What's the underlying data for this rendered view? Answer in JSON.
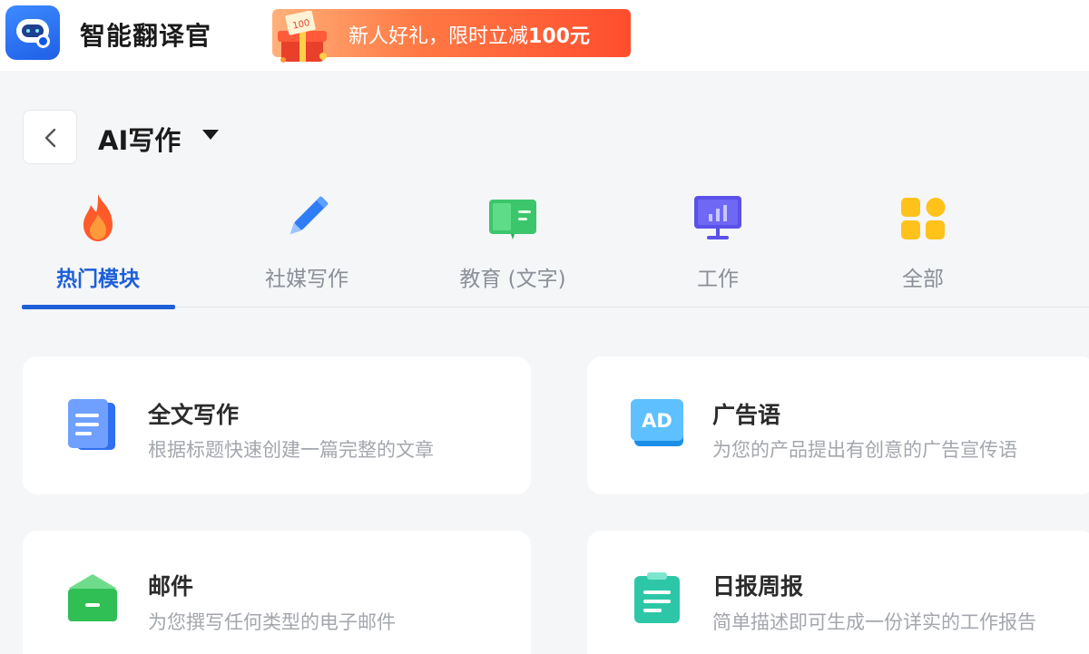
{
  "header": {
    "app_name": "智能翻译官",
    "promo": {
      "text_prefix": "新人好礼，限时立减",
      "amount": "100元",
      "coupon_value": "100"
    }
  },
  "page": {
    "title": "AI写作"
  },
  "tabs": [
    {
      "label": "热门模块",
      "icon": "fire-icon",
      "active": true
    },
    {
      "label": "社媒写作",
      "icon": "pencil-icon",
      "active": false
    },
    {
      "label": "教育 (文字)",
      "icon": "book-icon",
      "active": false
    },
    {
      "label": "工作",
      "icon": "presentation-icon",
      "active": false
    },
    {
      "label": "全部",
      "icon": "grid-icon",
      "active": false
    }
  ],
  "cards": [
    {
      "title": "全文写作",
      "desc": "根据标题快速创建一篇完整的文章",
      "icon": "document-icon"
    },
    {
      "title": "广告语",
      "desc": "为您的产品提出有创意的广告宣传语",
      "icon": "ad-icon",
      "icon_text": "AD"
    },
    {
      "title": "邮件",
      "desc": "为您撰写任何类型的电子邮件",
      "icon": "mail-icon"
    },
    {
      "title": "日报周报",
      "desc": "简单描述即可生成一份详实的工作报告",
      "icon": "clipboard-icon"
    }
  ],
  "colors": {
    "accent": "#1d5fd8",
    "promo_start": "#ffb07a",
    "promo_end": "#ff4d2e",
    "muted_text": "#a3a7ad"
  }
}
